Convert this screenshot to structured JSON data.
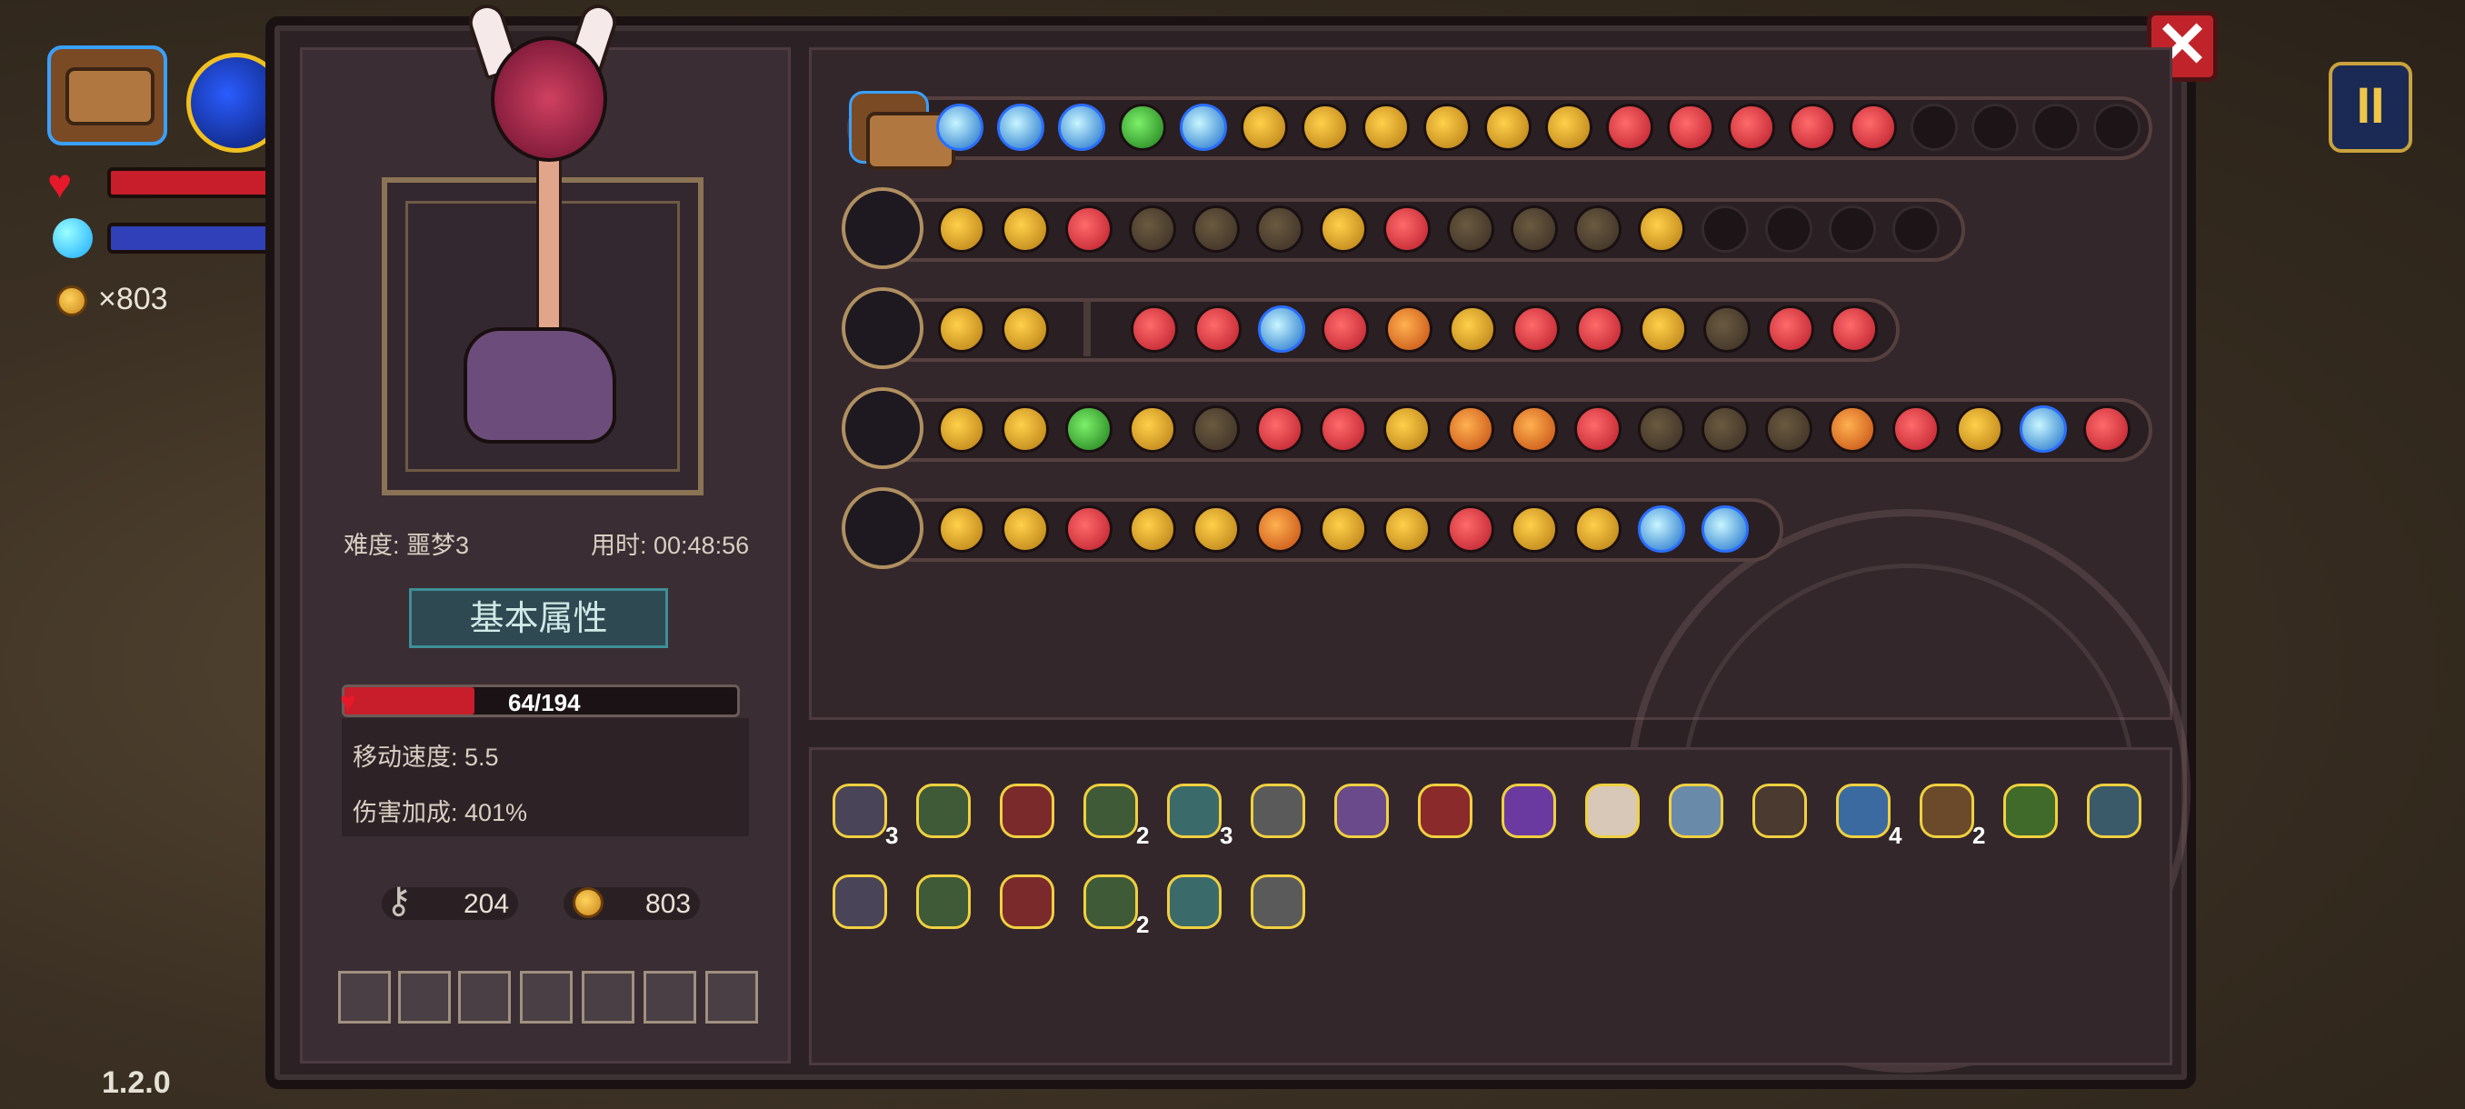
{
  "hud": {
    "coins_text": "×803",
    "version": "1.2.0"
  },
  "stats": {
    "difficulty": "难度: 噩梦3",
    "time": "用时: 00:48:56",
    "section_title": "基本属性",
    "hp": "64/194",
    "hp_fraction": 0.33,
    "move_speed": "移动速度: 5.5",
    "damage_bonus": "伤害加成: 401%",
    "keys": "204",
    "coins": "803"
  },
  "item_counts": {
    "mask": "3",
    "gem": "3",
    "boot": "2",
    "lens": "4",
    "pickaxe": "2",
    "sword": "2"
  },
  "close_glyph": "✕"
}
